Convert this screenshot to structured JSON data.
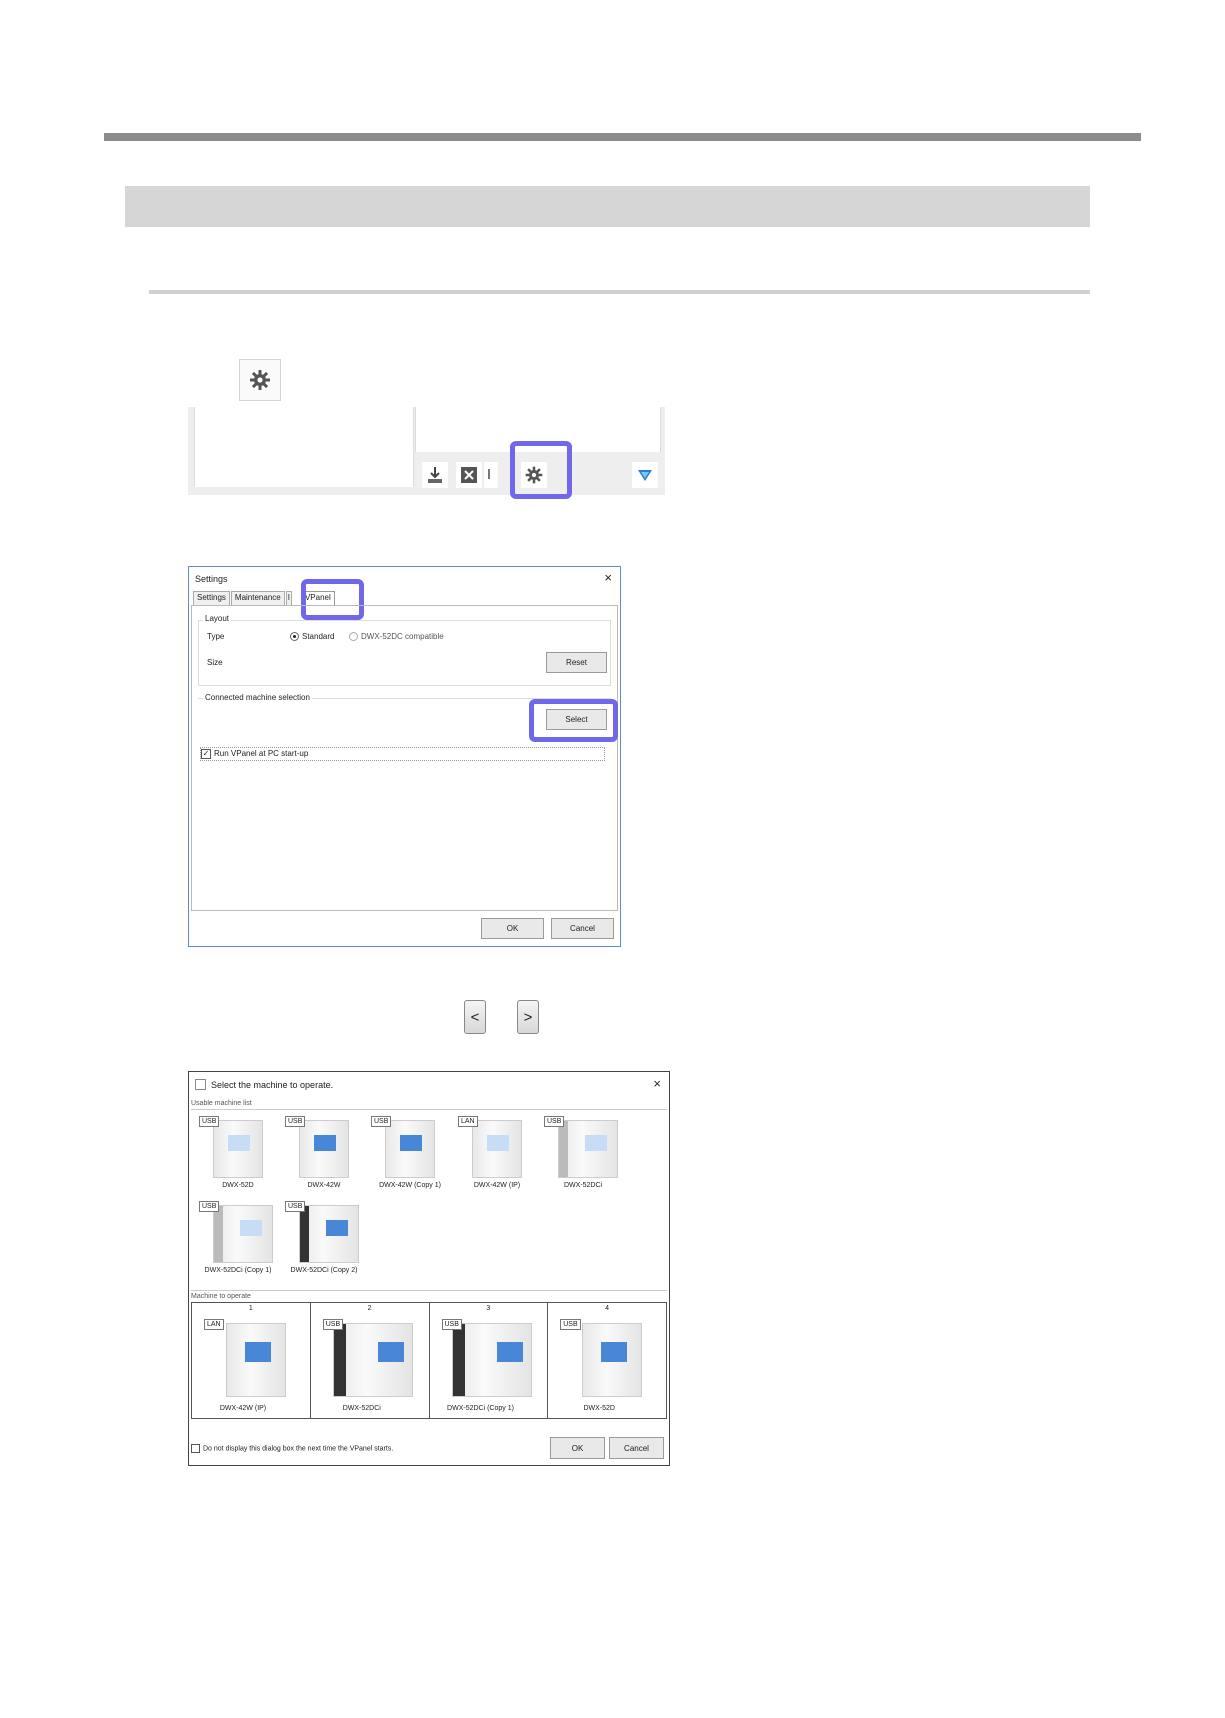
{
  "settings_dialog": {
    "title": "Settings",
    "close": "×",
    "tabs": [
      "Settings",
      "Maintenance",
      "I",
      "VPanel"
    ],
    "layout_group": "Layout",
    "type_label": "Type",
    "type_options": [
      "Standard",
      "DWX-52DC compatible"
    ],
    "size_label": "Size",
    "reset_label": "Reset",
    "connected_group": "Connected machine selection",
    "select_label": "Select",
    "startup_checkbox": "Run VPanel at PC start-up",
    "ok_label": "OK",
    "cancel_label": "Cancel"
  },
  "nav": {
    "prev": "<",
    "next": ">"
  },
  "machine_dialog": {
    "title": "Select the machine to operate.",
    "close": "×",
    "usable_label": "Usable machine list",
    "usable_machines": [
      {
        "tag": "USB",
        "name": "DWX-52D"
      },
      {
        "tag": "USB",
        "name": "DWX-42W"
      },
      {
        "tag": "USB",
        "name": "DWX-42W (Copy 1)"
      },
      {
        "tag": "LAN",
        "name": "DWX-42W (IP)"
      },
      {
        "tag": "USB",
        "name": "DWX-52DCi"
      },
      {
        "tag": "USB",
        "name": "DWX-52DCi (Copy 1)"
      },
      {
        "tag": "USB",
        "name": "DWX-52DCi (Copy 2)"
      }
    ],
    "operate_label": "Machine to operate",
    "operate_slots": [
      {
        "num": "1",
        "tag": "LAN",
        "name": "DWX-42W (IP)"
      },
      {
        "num": "2",
        "tag": "USB",
        "name": "DWX-52DCi"
      },
      {
        "num": "3",
        "tag": "USB",
        "name": "DWX-52DCi (Copy 1)"
      },
      {
        "num": "4",
        "tag": "USB",
        "name": "DWX-52D"
      }
    ],
    "dont_show": "Do not display this dialog box the next time the VPanel starts.",
    "ok_label": "OK",
    "cancel_label": "Cancel"
  },
  "colors": {
    "highlight": "#7068e8",
    "dialog_border": "#5d8bd6",
    "rule": "#8c8c8c",
    "heading_band": "#d6d6d6"
  }
}
